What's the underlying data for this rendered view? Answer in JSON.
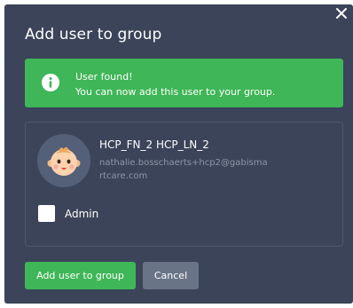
{
  "dialog": {
    "title": "Add user to group",
    "close_icon": "close-icon"
  },
  "alert": {
    "icon": "info-icon",
    "line1": "User found!",
    "line2": "You can now add this user to your group."
  },
  "user": {
    "name": "HCP_FN_2 HCP_LN_2",
    "email": "nathalie.bosschaerts+hcp2@gabismartcare.com",
    "avatar": "baby-face-avatar"
  },
  "admin_checkbox": {
    "label": "Admin",
    "checked": false
  },
  "buttons": {
    "add_label": "Add user to group",
    "cancel_label": "Cancel"
  },
  "colors": {
    "dialog_bg": "#3b4459",
    "success": "#3fb657",
    "secondary_button": "#6a7487",
    "muted_text": "#8e96a7"
  }
}
